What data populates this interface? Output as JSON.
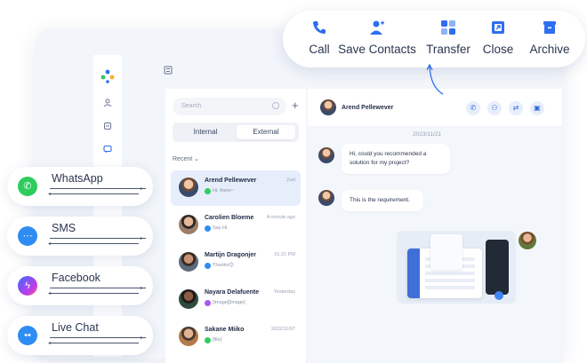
{
  "action_bar": {
    "items": [
      {
        "label": "Call",
        "icon": "phone-icon"
      },
      {
        "label": "Save Contacts",
        "icon": "add-contact-icon"
      },
      {
        "label": "Transfer",
        "icon": "transfer-icon"
      },
      {
        "label": "Close",
        "icon": "close-window-icon"
      },
      {
        "label": "Archive",
        "icon": "archive-icon"
      }
    ],
    "accent": "#2e6ef0"
  },
  "conversations": {
    "search_placeholder": "Search",
    "tabs": [
      "Internal",
      "External"
    ],
    "active_tab": "External",
    "section_label": "Recent",
    "rows": [
      {
        "name": "Arend Pellewever",
        "time": "Just",
        "preview": "Hi, there~",
        "channel_color": "#2ecc5d",
        "selected": true
      },
      {
        "name": "Carolien Bloeme",
        "time": "A minute ago",
        "preview": "Say Hi.",
        "channel_color": "#2f8cf2",
        "selected": false
      },
      {
        "name": "Martijn Dragonjer",
        "time": "01:21 PM",
        "preview": "Thanks😊",
        "channel_color": "#2f8cf2",
        "selected": false
      },
      {
        "name": "Nayara Delafuente",
        "time": "Yesterday",
        "preview": "[Image][Image]",
        "channel_color": "#a55cf0",
        "selected": false
      },
      {
        "name": "Sakane Miiko",
        "time": "2022/11/07",
        "preview": "[file]",
        "channel_color": "#2ecc5d",
        "selected": false
      }
    ]
  },
  "chat": {
    "contact_name": "Arend Pellewever",
    "date": "2023/11/21",
    "messages": [
      "Hi, could you recommended a solution for my project?",
      "This is the requirement."
    ]
  },
  "channels": [
    {
      "label": "WhatsApp",
      "icon": "whatsapp-icon",
      "color": "#2ecc5d"
    },
    {
      "label": "SMS",
      "icon": "sms-icon",
      "color": "#2f8cf2"
    },
    {
      "label": "Facebook",
      "icon": "messenger-icon",
      "color": "#7a4ff0"
    },
    {
      "label": "Live Chat",
      "icon": "live-chat-icon",
      "color": "#2f8cf2"
    }
  ]
}
